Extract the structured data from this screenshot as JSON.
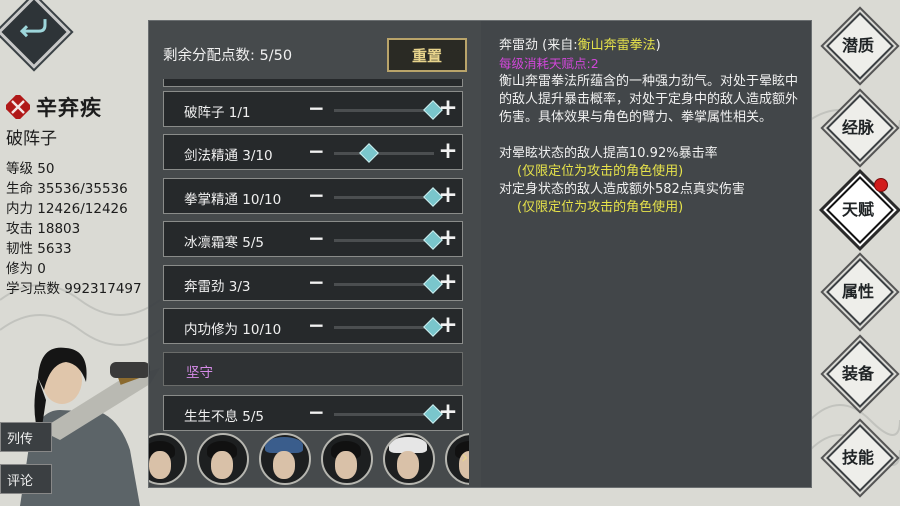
{
  "character": {
    "name": "辛弃疾",
    "title": "破阵子",
    "stats": [
      "等级 50",
      "生命 35536/35536",
      "内力 12426/12426",
      "攻击 18803",
      "韧性 5633",
      "修为 0",
      "学习点数 992317497"
    ]
  },
  "side_tabs": {
    "biography": "列传",
    "comments": "评论"
  },
  "panel": {
    "points_label": "剩余分配点数: 5/50",
    "reset_label": "重置",
    "talents": [
      {
        "name": "破阵子 1/1",
        "level": 1.0
      },
      {
        "name": "剑法精通 3/10",
        "level": 0.3
      },
      {
        "name": "拳掌精通 10/10",
        "level": 1.0
      },
      {
        "name": "冰凛霜寒 5/5",
        "level": 1.0
      },
      {
        "name": "奔雷劲 3/3",
        "level": 1.0
      },
      {
        "name": "内功修为 10/10",
        "level": 1.0
      }
    ],
    "section_header": "坚守",
    "talents_defense": [
      {
        "name": "生生不息 5/5",
        "level": 1.0
      }
    ]
  },
  "description": {
    "title_prefix": "奔雷劲 (来自:",
    "title_source": "衡山奔雷拳法",
    "title_suffix": ")",
    "cost": "每级消耗天赋点:2",
    "body": "衡山奔雷拳法所蕴含的一种强力劲气。对处于晕眩中的敌人提升暴击概率，对处于定身中的敌人造成额外伤害。具体效果与角色的臂力、拳掌属性相关。",
    "effect1": "对晕眩状态的敌人提高10.92%暴击率",
    "effect1_note": "(仅限定位为攻击的角色使用)",
    "effect2": "对定身状态的敌人造成额外582点真实伤害",
    "effect2_note": "(仅限定位为攻击的角色使用)"
  },
  "nav": [
    {
      "label": "潜质",
      "active": false
    },
    {
      "label": "经脉",
      "active": false
    },
    {
      "label": "天赋",
      "active": true,
      "notify": true
    },
    {
      "label": "属性",
      "active": false
    },
    {
      "label": "装备",
      "active": false
    },
    {
      "label": "技能",
      "active": false
    }
  ],
  "icons": {
    "back": "back-arrow-icon",
    "char_emblem": "crossed-swords-icon",
    "strip_next": "chevron-right-icon"
  },
  "colors": {
    "accent_yellow": "#e6e24a",
    "cost_purple": "#d147d9",
    "knob": "#7ac6cc",
    "section_purple": "#d68be8"
  }
}
